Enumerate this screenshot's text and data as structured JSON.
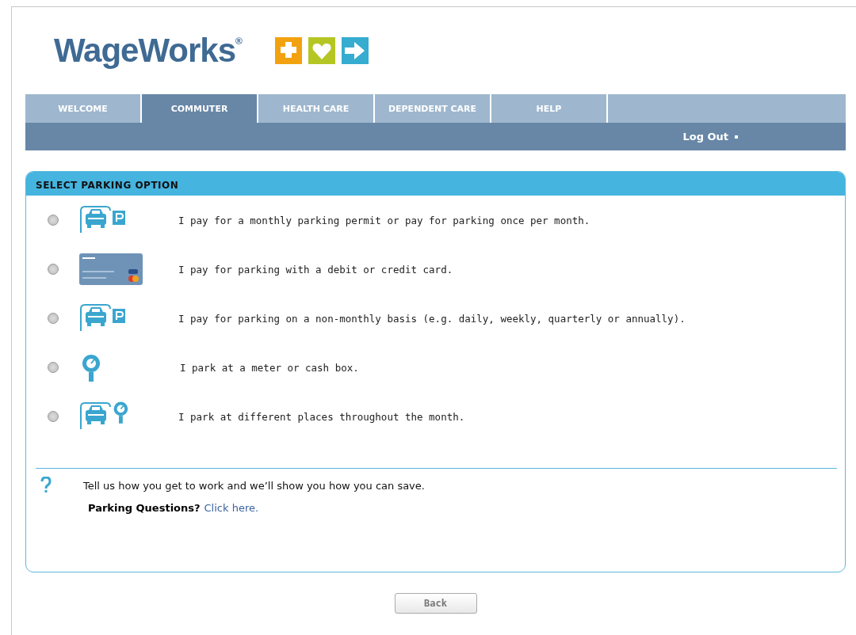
{
  "logo": {
    "name": "WageWorks",
    "mark": "®"
  },
  "nav": {
    "tabs": [
      {
        "label": "WELCOME",
        "selected": false
      },
      {
        "label": "COMMUTER",
        "selected": true
      },
      {
        "label": "HEALTH CARE",
        "selected": false
      },
      {
        "label": "DEPENDENT CARE",
        "selected": false
      },
      {
        "label": "HELP",
        "selected": false
      }
    ],
    "logout": "Log Out"
  },
  "panel": {
    "title": "SELECT PARKING OPTION",
    "options": [
      {
        "kind": "permit",
        "label": "I pay for a monthly parking permit or pay for parking once per month.",
        "selected": false
      },
      {
        "kind": "card",
        "label": "I pay for parking with a debit or credit card.",
        "selected": false
      },
      {
        "kind": "permit",
        "label": "I pay for parking on a non-monthly basis (e.g. daily, weekly, quarterly or annually).",
        "selected": false
      },
      {
        "kind": "meter",
        "label": "I park at a meter or cash box.",
        "selected": false
      },
      {
        "kind": "mixed",
        "label": "I park at different places throughout the month.",
        "selected": false
      }
    ],
    "help_text": "Tell us how you get to work and we’ll show you how you can save.",
    "questions_label": "Parking Questions?",
    "questions_link": "Click here."
  },
  "back_button": "Back"
}
